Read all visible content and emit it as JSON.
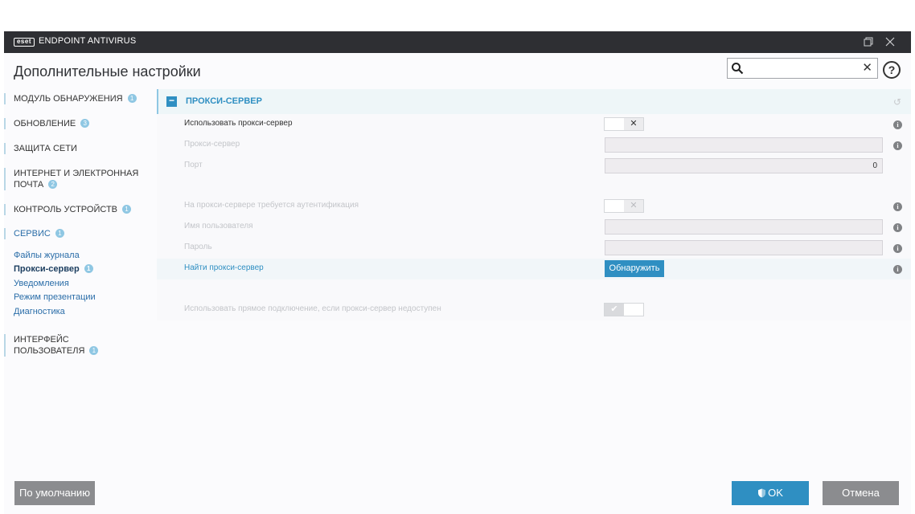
{
  "titlebar": {
    "logo": "eset",
    "app_name": "ENDPOINT ANTIVIRUS",
    "restore_icon": "restore-window-icon",
    "close_icon": "close-icon"
  },
  "header": {
    "title": "Дополнительные настройки",
    "search_placeholder": "",
    "search_value": "",
    "help": "?"
  },
  "sidebar": {
    "items": [
      {
        "label": "МОДУЛЬ ОБНАРУЖЕНИЯ",
        "badge": "1"
      },
      {
        "label": "ОБНОВЛЕНИЕ",
        "badge": "3"
      },
      {
        "label": "ЗАЩИТА СЕТИ",
        "badge": ""
      },
      {
        "label_line1": "ИНТЕРНЕТ И ЭЛЕКТРОННАЯ",
        "label_line2": "ПОЧТА",
        "badge": "2"
      },
      {
        "label": "КОНТРОЛЬ УСТРОЙСТВ",
        "badge": "1"
      },
      {
        "label": "СЕРВИС",
        "badge": "1"
      },
      {
        "label_line1": "ИНТЕРФЕЙС",
        "label_line2": "ПОЛЬЗОВАТЕЛЯ",
        "badge": "1"
      }
    ],
    "subitems": [
      {
        "label": "Файлы журнала"
      },
      {
        "label": "Прокси-сервер",
        "badge": "1"
      },
      {
        "label": "Уведомления"
      },
      {
        "label": "Режим презентации"
      },
      {
        "label": "Диагностика"
      }
    ]
  },
  "section": {
    "title": "ПРОКСИ-СЕРВЕР",
    "collapse": "−",
    "revert_icon": "revert-icon",
    "rows": {
      "use_proxy": {
        "label": "Использовать прокси-сервер",
        "toggle": "✕"
      },
      "proxy_server": {
        "label": "Прокси-сервер",
        "value": ""
      },
      "port": {
        "label": "Порт",
        "value": "0"
      },
      "auth_required": {
        "label": "На прокси-сервере требуется аутентификация",
        "toggle": "✕"
      },
      "username": {
        "label": "Имя пользователя",
        "value": ""
      },
      "password": {
        "label": "Пароль",
        "value": ""
      },
      "find_proxy": {
        "label": "Найти прокси-сервер",
        "button": "Обнаружить"
      },
      "direct_connection": {
        "label": "Использовать прямое подключение, если прокси-сервер недоступен",
        "toggle": "✔"
      }
    },
    "info": "i"
  },
  "footer": {
    "default_button": "По умолчанию",
    "ok_button": "OK",
    "cancel_button": "Отмена"
  },
  "colors": {
    "accent": "#2f8fc2",
    "titlebar": "#2e2f33",
    "badge": "#8fc7e3",
    "button_gray": "#8b8c8f"
  }
}
